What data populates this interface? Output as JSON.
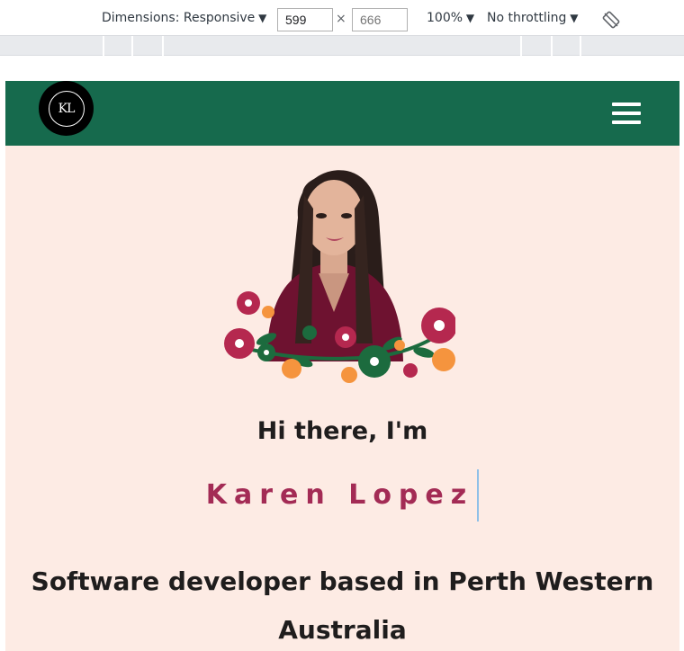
{
  "devtools": {
    "dimensions_label": "Dimensions: Responsive",
    "width_value": "599",
    "height_placeholder": "666",
    "times": "×",
    "zoom": "100%",
    "throttling": "No throttling"
  },
  "site": {
    "logo_text": "KL",
    "greeting": "Hi there, I'm",
    "name": "Karen Lopez",
    "tagline": "Software developer based in Perth Western Australia"
  },
  "colors": {
    "navbar": "#166a4d",
    "page_background": "#fdebe4",
    "name_accent": "#a32b55"
  }
}
